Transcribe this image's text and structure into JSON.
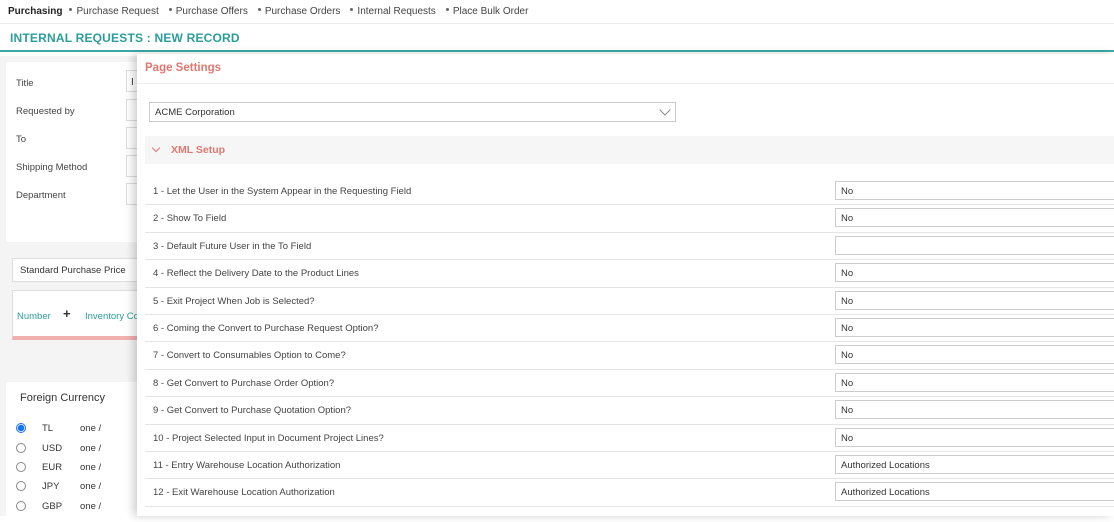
{
  "nav": {
    "items": [
      "Purchasing",
      "Purchase Request",
      "Purchase Offers",
      "Purchase Orders",
      "Internal Requests",
      "Place Bulk Order"
    ]
  },
  "header": {
    "title": "INTERNAL REQUESTS : NEW RECORD"
  },
  "form": {
    "fields": [
      "Title",
      "Requested by",
      "To",
      "Shipping Method",
      "Department"
    ],
    "title_value_partial": "I"
  },
  "price_select": {
    "value": "Standard Purchase Price"
  },
  "lines_table": {
    "columns": [
      "Number",
      "+",
      "Inventory Co"
    ]
  },
  "currency": {
    "title": "Foreign Currency",
    "options": [
      {
        "code": "TL",
        "value": "one /",
        "selected": true
      },
      {
        "code": "USD",
        "value": "one /",
        "selected": false
      },
      {
        "code": "EUR",
        "value": "one /",
        "selected": false
      },
      {
        "code": "JPY",
        "value": "one /",
        "selected": false
      },
      {
        "code": "GBP",
        "value": "one /",
        "selected": false
      }
    ]
  },
  "page_settings": {
    "title": "Page Settings",
    "company": "ACME Corporation",
    "xml_section": "XML Setup",
    "settings": [
      {
        "label": "1 - Let the User in the System Appear in the Requesting Field",
        "value": "No"
      },
      {
        "label": "2 - Show To Field",
        "value": "No"
      },
      {
        "label": "3 - Default Future User in the To Field",
        "value": ""
      },
      {
        "label": "4 - Reflect the Delivery Date to the Product Lines",
        "value": "No"
      },
      {
        "label": "5 - Exit Project When Job is Selected?",
        "value": "No"
      },
      {
        "label": "6 - Coming the Convert to Purchase Request Option?",
        "value": "No"
      },
      {
        "label": "7 - Convert to Consumables Option to Come?",
        "value": "No"
      },
      {
        "label": "8 - Get Convert to Purchase Order Option?",
        "value": "No"
      },
      {
        "label": "9 - Get Convert to Purchase Quotation Option?",
        "value": "No"
      },
      {
        "label": "10 - Project Selected Input in Document Project Lines?",
        "value": "No"
      },
      {
        "label": "11 - Entry Warehouse Location Authorization",
        "value": "Authorized Locations"
      },
      {
        "label": "12 - Exit Warehouse Location Authorization",
        "value": "Authorized Locations"
      }
    ]
  },
  "colors": {
    "accent": "#2b9e9a",
    "panel_title": "#e07870"
  }
}
